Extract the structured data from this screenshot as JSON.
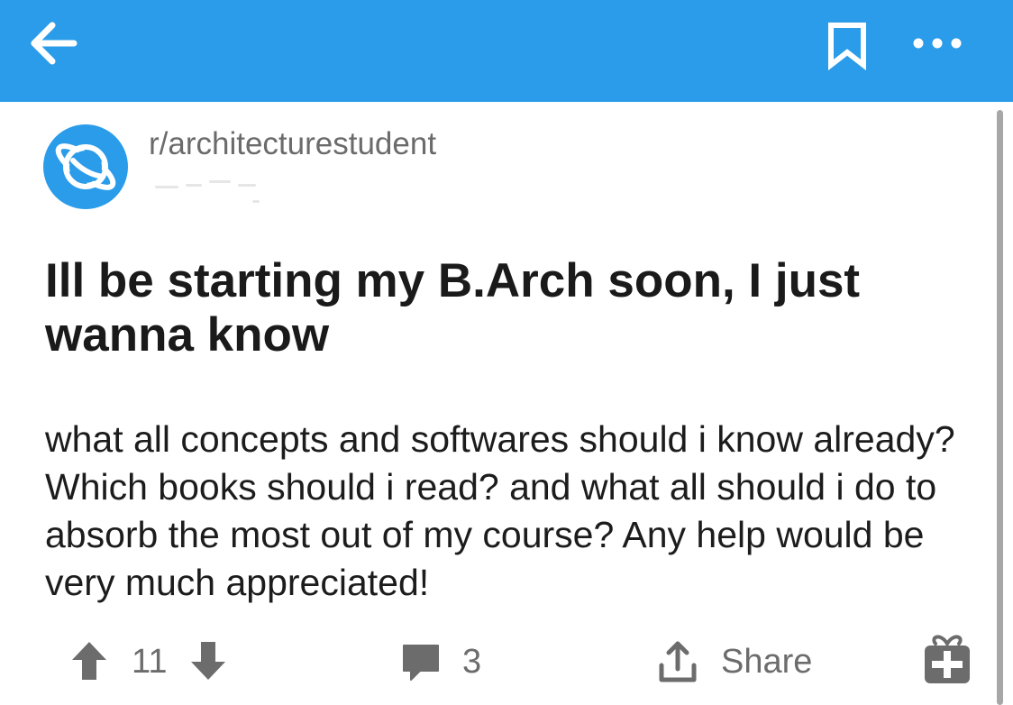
{
  "header": {
    "back_icon": "arrow-left-icon",
    "bookmark_icon": "bookmark-icon",
    "more_icon": "more-horizontal-icon",
    "bar_color": "#2a9ce9"
  },
  "post": {
    "subreddit": "r/architecturestudent",
    "subreddit_icon": "planet-icon",
    "title": "Ill be starting my B.Arch soon, I just wanna know",
    "body": "what all concepts and softwares should i know already? Which books should i read? and what all should i do to absorb the most out of my course? Any help would be very much appreciated!"
  },
  "actions": {
    "upvote_icon": "arrow-up-icon",
    "score": "11",
    "downvote_icon": "arrow-down-icon",
    "comment_icon": "comment-icon",
    "comments_count": "3",
    "share_icon": "share-icon",
    "share_label": "Share",
    "award_icon": "gift-icon"
  },
  "colors": {
    "accent": "#2a9ce9",
    "action_gray": "#6c6c6c",
    "subreddit_gray": "#6b6b6b"
  }
}
